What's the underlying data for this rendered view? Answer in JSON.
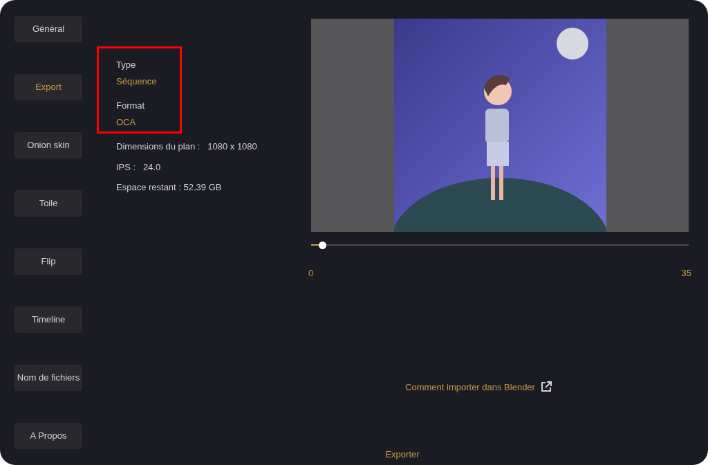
{
  "sidebar": {
    "items": [
      {
        "label": "Général",
        "selected": false
      },
      {
        "label": "Export",
        "selected": true
      },
      {
        "label": "Onion skin",
        "selected": false
      },
      {
        "label": "Toile",
        "selected": false
      },
      {
        "label": "Flip",
        "selected": false
      },
      {
        "label": "Timeline",
        "selected": false
      },
      {
        "label": "Nom de fichiers",
        "selected": false
      },
      {
        "label": "A Propos",
        "selected": false
      }
    ]
  },
  "settings": [
    {
      "label": "Type",
      "value": "Séquence"
    },
    {
      "label": "Format",
      "value": "OCA"
    }
  ],
  "info": [
    "Dimensions du plan :   1080 x 1080",
    "IPS :   24.0",
    "Espace restant : 52.39 GB"
  ],
  "timeline": {
    "level": 0.03,
    "start": "0",
    "end": "35"
  },
  "help_link": "Comment importer dans Blender",
  "export_button": "Exporter"
}
